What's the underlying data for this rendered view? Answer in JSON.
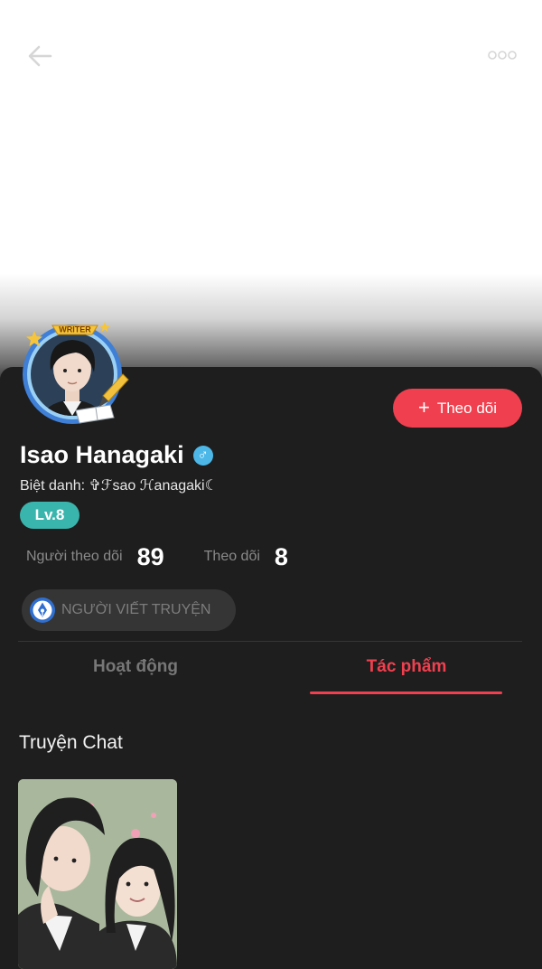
{
  "header": {
    "back_icon": "back-arrow-icon",
    "more_icon": "more-dots-icon"
  },
  "profile": {
    "avatar_badge": "WRITER",
    "name": "Isao Hanagaki",
    "gender_symbol": "♂",
    "nickname": "Biệt danh: ✞ℱsao ℋanagaki☾",
    "level": "Lv.8",
    "follow_button": "Theo dõi",
    "followers_label": "Người theo dõi",
    "followers_count": "89",
    "following_label": "Theo dõi",
    "following_count": "8",
    "role_chip": "NGƯỜI VIẾT TRUYỆN"
  },
  "tabs": [
    {
      "label": "Hoạt động",
      "active": false
    },
    {
      "label": "Tác phẩm",
      "active": true
    }
  ],
  "section": {
    "title": "Truyện Chat"
  },
  "colors": {
    "accent": "#f0404f",
    "background": "#1e1e1e",
    "level_badge": "#3ab5ad",
    "gender_badge": "#4db8e8"
  }
}
